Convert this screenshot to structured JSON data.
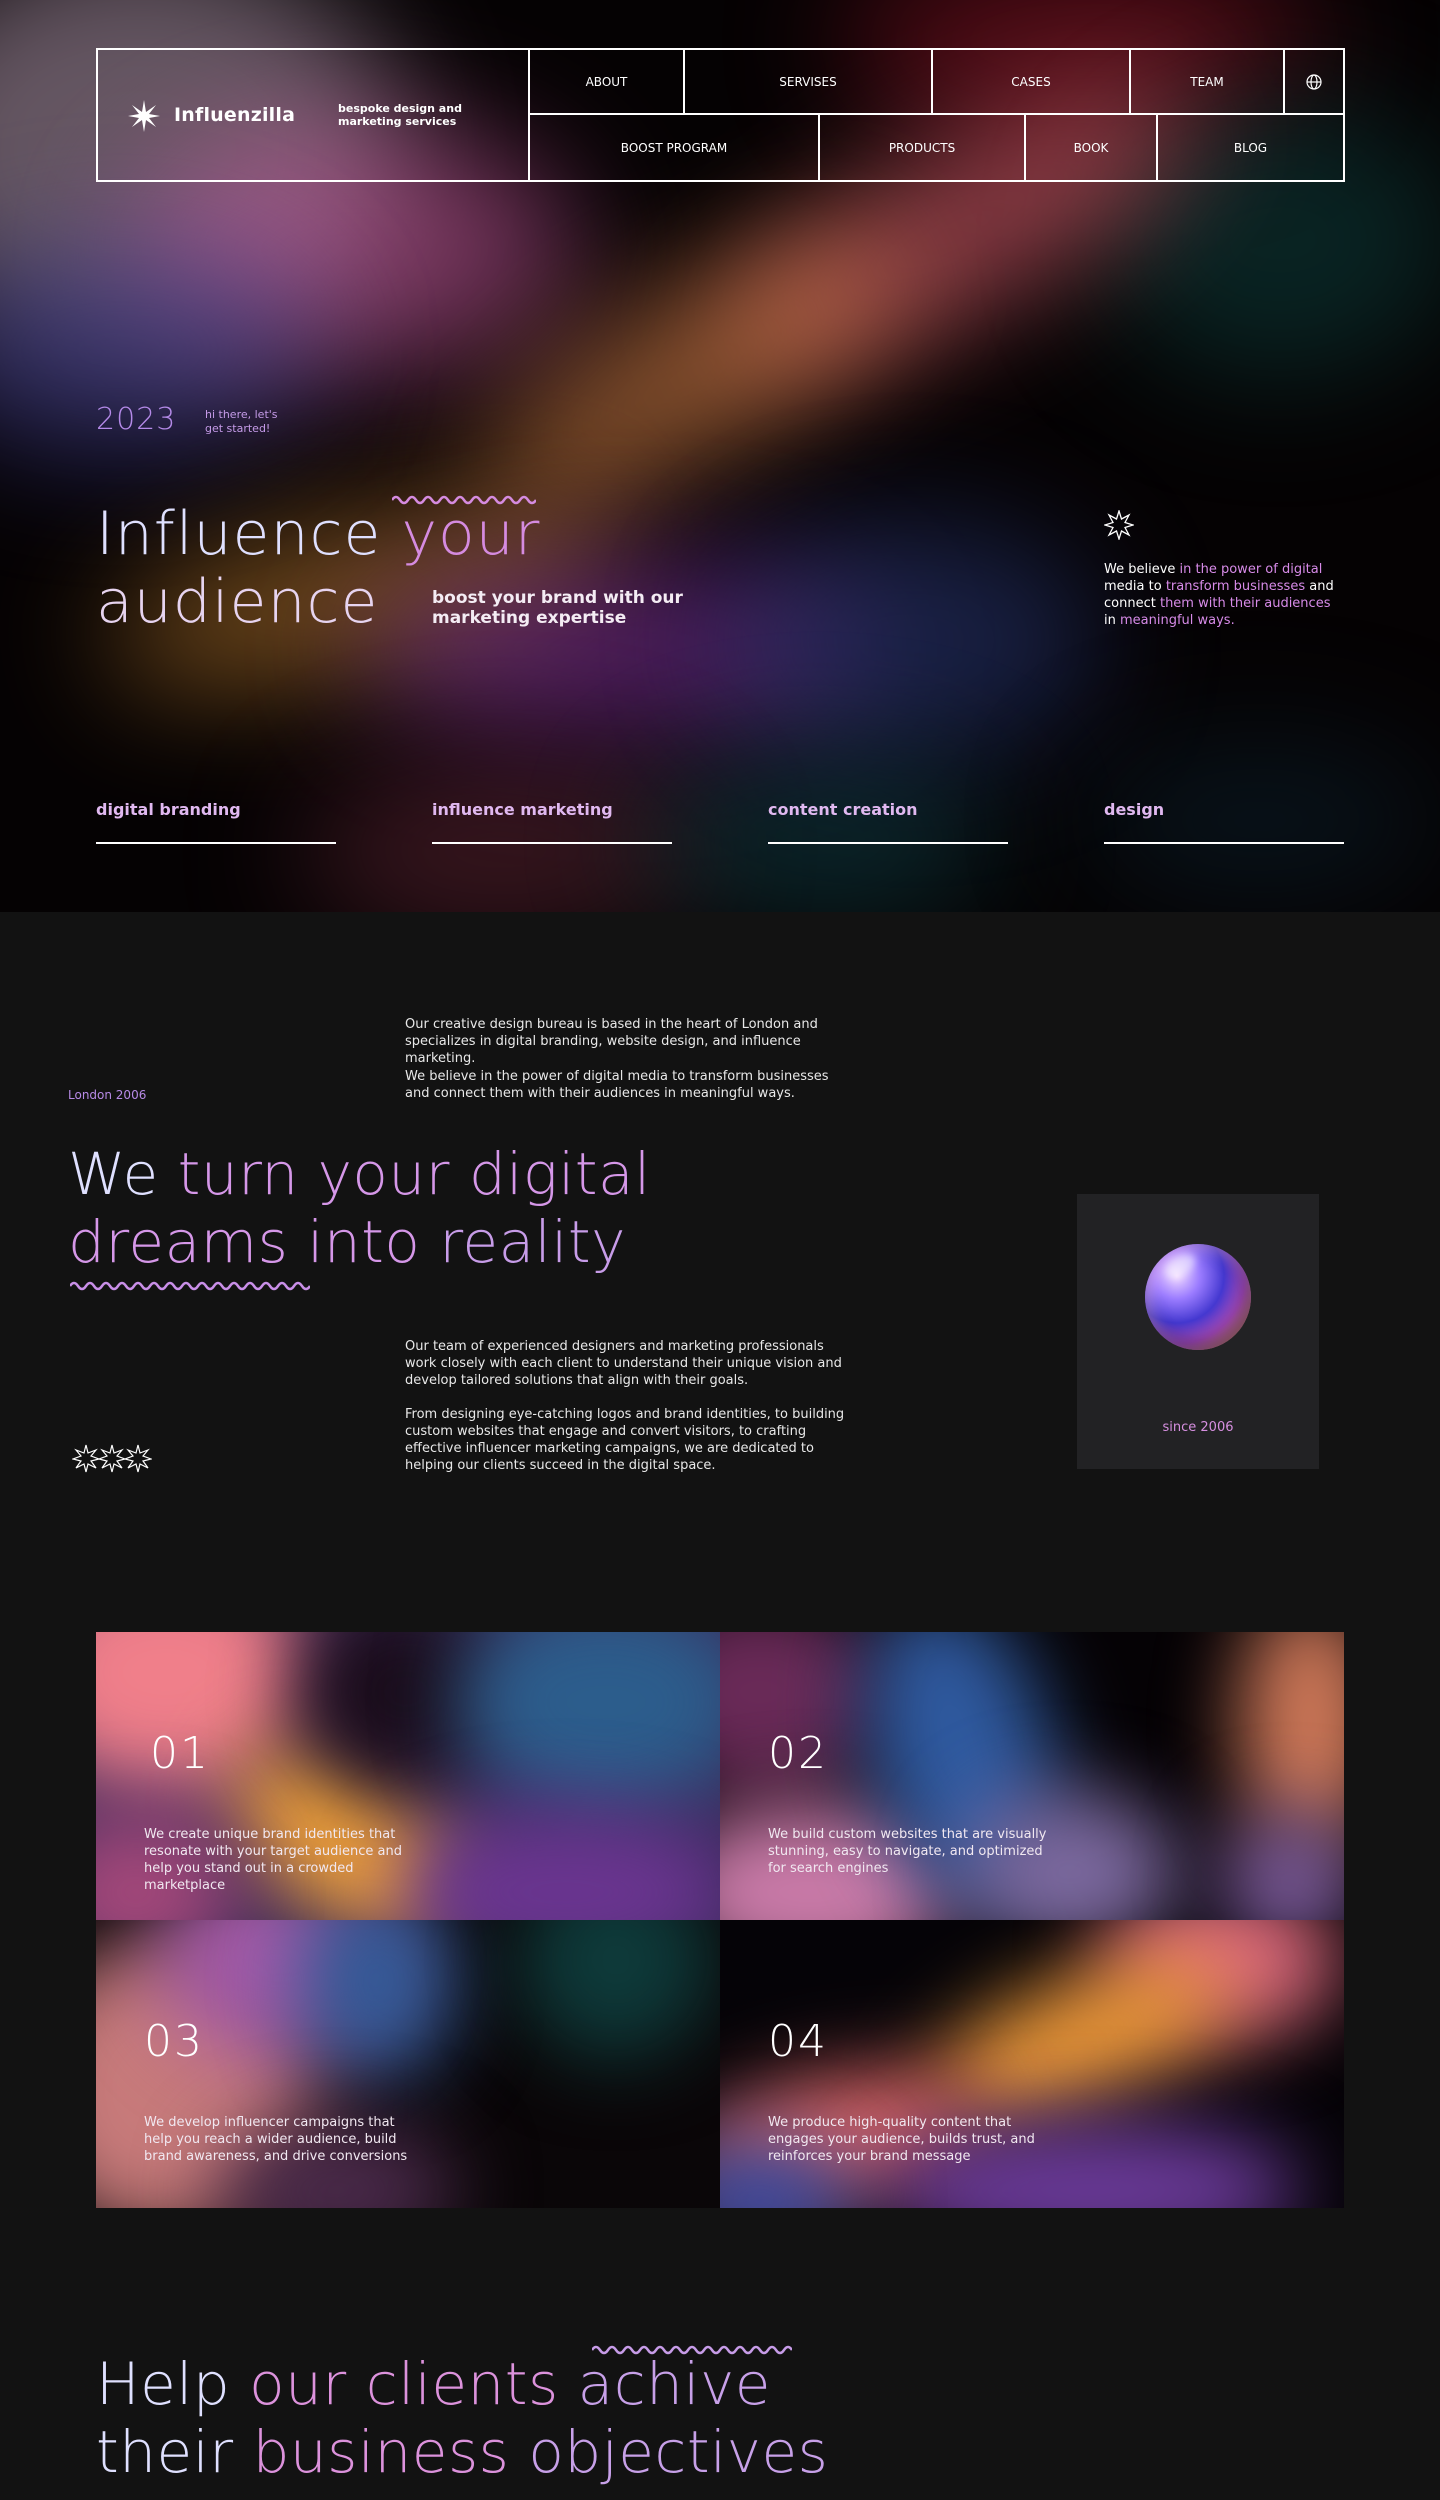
{
  "nav": {
    "logo_name": "Influenzilla",
    "tagline": "bespoke design and marketing services",
    "row1": [
      "ABOUT",
      "SERVISES",
      "CASES",
      "TEAM"
    ],
    "row2": [
      "BOOST PROGRAM",
      "PRODUCTS",
      "BOOK",
      "BLOG"
    ],
    "globe_icon": "globe-icon"
  },
  "hero": {
    "year": "2023",
    "hi": "hi there, let's get started!",
    "title_l1a": "Influence ",
    "title_l1b": "your",
    "title_l2": "audience",
    "subtitle": "boost your brand with our marketing expertise",
    "belief_1": "We believe ",
    "belief_2": "in the power of digital",
    "belief_3": " media to ",
    "belief_4": "transform businesses",
    "belief_5": " and connect ",
    "belief_6": "them with their audiences",
    "belief_7": " in ",
    "belief_8": "meaningful ways.",
    "services": [
      "digital branding",
      "influence marketing",
      "content creation",
      "design"
    ]
  },
  "about": {
    "p1": "Our creative design bureau is based in the heart of London and specializes in digital branding, website design, and influence marketing.",
    "p2": "We believe in the power of digital media to transform businesses and connect them with their audiences in meaningful ways.",
    "london": "London 2006",
    "title_w1": "We ",
    "title_w2": "turn your digital",
    "title_w3": "dreams into ",
    "title_w4": "reality",
    "p3": "Our team of experienced designers and marketing professionals work closely with each client to understand their unique vision and develop tailored solutions that align with their goals.",
    "p4": "From designing eye-catching logos and brand identities, to building custom websites that engage and convert visitors, to crafting effective influencer marketing campaigns, we are dedicated to helping our clients succeed in the digital space.",
    "since": "since 2006"
  },
  "cards": [
    {
      "num": "01",
      "desc": "We create unique brand identities that resonate with your target audience and help you stand out in a crowded marketplace"
    },
    {
      "num": "02",
      "desc": "We build custom websites that are visually stunning, easy to navigate, and optimized for search engines"
    },
    {
      "num": "03",
      "desc": "We develop influencer campaigns that help you reach a wider audience, build brand awareness, and drive conversions"
    },
    {
      "num": "04",
      "desc": "We produce high-quality content that engages your audience, builds trust, and reinforces your brand message"
    }
  ],
  "bottom": {
    "a1": "Help ",
    "b1": "our clients ",
    "c1": "achive",
    "a2": "their ",
    "b2": "business ",
    "c2": "objectives"
  },
  "colors": {
    "accent_pink": "#d78be8",
    "accent_lavender": "#c79ce8",
    "title_light": "#dfe0ff",
    "background": "#121212"
  }
}
